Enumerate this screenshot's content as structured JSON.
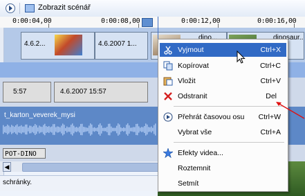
{
  "toolbar": {
    "storyboard_label": "Zobrazit scénář"
  },
  "ruler": {
    "ticks": [
      "0:00:04,00",
      "0:00:08,00",
      "0:00:12,00",
      "0:00:16,00"
    ]
  },
  "video_track": {
    "clips": [
      "4.6.2...",
      "4.6.2007 1...",
      "dino...",
      "dinosaur..."
    ]
  },
  "transition_track": {
    "clips": [
      "5:57",
      "4.6.2007 15:57"
    ]
  },
  "audio_track": {
    "clip_name": "t_karton_veverek_mysi"
  },
  "title_track": {
    "clip_name": "POT-DINO"
  },
  "status_bar": {
    "text": "schránky."
  },
  "context_menu": {
    "items": [
      {
        "label": "Vyjmout",
        "shortcut": "Ctrl+X",
        "icon": "scissors-icon"
      },
      {
        "label": "Kopírovat",
        "shortcut": "Ctrl+C",
        "icon": "copy-icon"
      },
      {
        "label": "Vložit",
        "shortcut": "Ctrl+V",
        "icon": "paste-icon"
      },
      {
        "label": "Odstranit",
        "shortcut": "Del",
        "icon": "delete-icon"
      },
      {
        "label": "Přehrát časovou osu",
        "shortcut": "Ctrl+W",
        "icon": "play-icon"
      },
      {
        "label": "Vybrat vše",
        "shortcut": "Ctrl+A",
        "icon": ""
      },
      {
        "label": "Efekty videa...",
        "shortcut": "",
        "icon": "effects-icon"
      },
      {
        "label": "Roztemnit",
        "shortcut": "",
        "icon": ""
      },
      {
        "label": "Setmít",
        "shortcut": "",
        "icon": ""
      }
    ]
  },
  "colors": {
    "menu_highlight": "#316ac5",
    "delete_icon": "#d42020",
    "annotation_arrow": "#e01010"
  }
}
